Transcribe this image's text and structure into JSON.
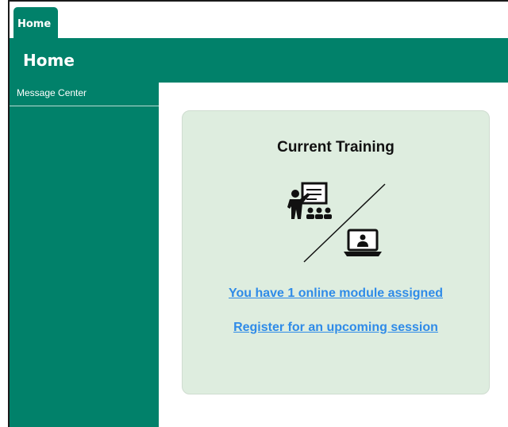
{
  "tabs": [
    {
      "label": "Home"
    }
  ],
  "header": {
    "title": "Home"
  },
  "sidebar": {
    "items": [
      {
        "label": "Message Center"
      }
    ]
  },
  "card": {
    "title": "Current Training",
    "icon": "training-classroom-and-online-icon",
    "links": [
      {
        "label": "You have 1 online module assigned"
      },
      {
        "label": "Register for an upcoming session"
      }
    ]
  },
  "colors": {
    "brand": "#01816a",
    "card_background": "#deeddf",
    "link": "#2f8be8"
  }
}
